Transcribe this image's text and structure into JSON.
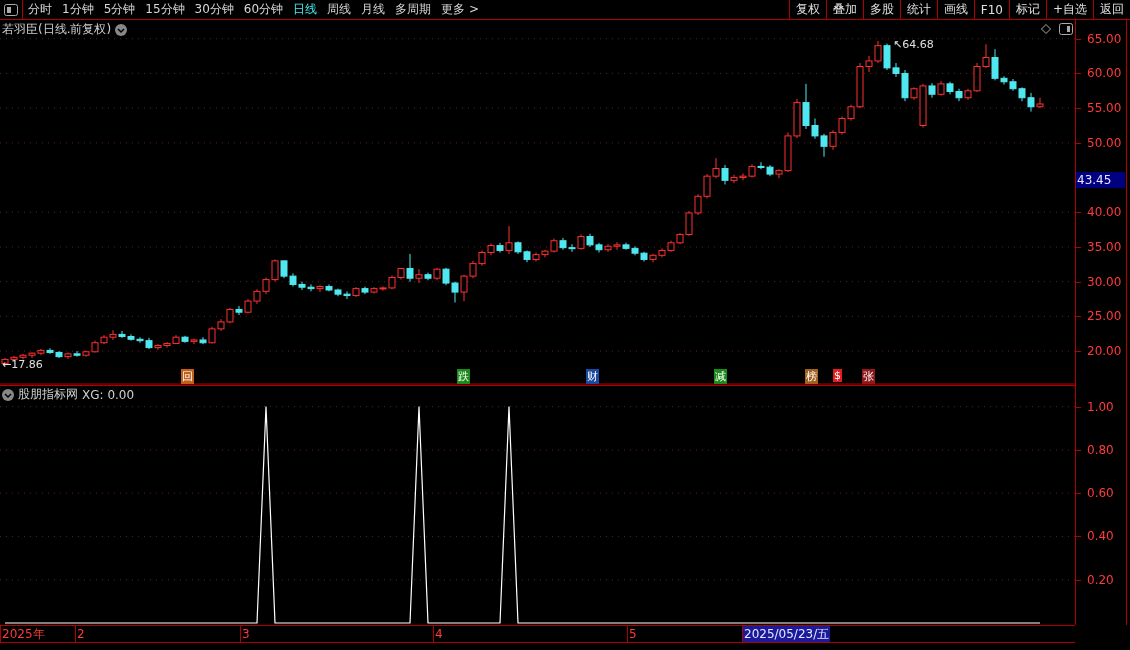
{
  "toolbar": {
    "periods": [
      {
        "label": "分时",
        "selected": false
      },
      {
        "label": "1分钟",
        "selected": false
      },
      {
        "label": "5分钟",
        "selected": false
      },
      {
        "label": "15分钟",
        "selected": false
      },
      {
        "label": "30分钟",
        "selected": false
      },
      {
        "label": "60分钟",
        "selected": false
      },
      {
        "label": "日线",
        "selected": true
      },
      {
        "label": "周线",
        "selected": false
      },
      {
        "label": "月线",
        "selected": false
      },
      {
        "label": "多周期",
        "selected": false
      }
    ],
    "more": "更多 >",
    "buttons": [
      "复权",
      "叠加",
      "多股",
      "统计",
      "画线",
      "F10",
      "标记",
      "+自选",
      "返回"
    ]
  },
  "main_chart": {
    "title": "若羽臣(日线.前复权)",
    "high_label": "↖64.68",
    "low_label": "←17.86",
    "current_price": "43.45",
    "chart_data": {
      "type": "candlestick",
      "grid": true,
      "ylim": [
        15.4,
        67.7
      ],
      "yticks": [
        {
          "value": 65,
          "label": "65.00"
        },
        {
          "value": 60,
          "label": "60.00"
        },
        {
          "value": 55,
          "label": "55.00"
        },
        {
          "value": 50,
          "label": "50.00"
        },
        {
          "value": 40,
          "label": "40.00"
        },
        {
          "value": 35,
          "label": "35.00"
        },
        {
          "value": 30,
          "label": "30.00"
        },
        {
          "value": 25,
          "label": "25.00"
        },
        {
          "value": 20,
          "label": "20.00"
        }
      ],
      "ohlc": [
        [
          18.2,
          19.0,
          17.86,
          18.8
        ],
        [
          18.8,
          19.3,
          18.5,
          19.1
        ],
        [
          19.1,
          19.6,
          18.8,
          19.4
        ],
        [
          19.4,
          19.8,
          19.0,
          19.7
        ],
        [
          19.7,
          20.3,
          19.4,
          20.1
        ],
        [
          20.1,
          20.4,
          19.6,
          19.8
        ],
        [
          19.8,
          20.0,
          19.0,
          19.2
        ],
        [
          19.2,
          19.8,
          18.9,
          19.6
        ],
        [
          19.6,
          20.0,
          19.2,
          19.4
        ],
        [
          19.4,
          20.1,
          19.2,
          19.9
        ],
        [
          19.9,
          21.5,
          19.8,
          21.2
        ],
        [
          21.2,
          22.3,
          21.0,
          22.0
        ],
        [
          22.0,
          23.0,
          21.6,
          22.4
        ],
        [
          22.4,
          22.9,
          21.9,
          22.1
        ],
        [
          22.1,
          22.4,
          21.5,
          21.7
        ],
        [
          21.7,
          22.0,
          21.2,
          21.5
        ],
        [
          21.5,
          21.9,
          20.3,
          20.5
        ],
        [
          20.5,
          21.0,
          20.2,
          20.8
        ],
        [
          20.8,
          21.3,
          20.5,
          21.1
        ],
        [
          21.1,
          22.3,
          21.0,
          22.0
        ],
        [
          22.0,
          22.2,
          21.2,
          21.4
        ],
        [
          21.4,
          21.8,
          21.0,
          21.6
        ],
        [
          21.6,
          22.0,
          21.0,
          21.2
        ],
        [
          21.2,
          23.5,
          21.1,
          23.2
        ],
        [
          23.2,
          24.6,
          22.9,
          24.2
        ],
        [
          24.2,
          26.2,
          24.0,
          26.0
        ],
        [
          26.0,
          26.5,
          25.2,
          25.6
        ],
        [
          25.6,
          27.5,
          25.4,
          27.2
        ],
        [
          27.2,
          28.9,
          26.8,
          28.6
        ],
        [
          28.6,
          30.6,
          28.2,
          30.3
        ],
        [
          30.3,
          33.2,
          30.0,
          33.0
        ],
        [
          33.0,
          33.0,
          30.5,
          30.8
        ],
        [
          30.8,
          31.2,
          29.3,
          29.6
        ],
        [
          29.6,
          30.0,
          28.8,
          29.2
        ],
        [
          29.2,
          29.6,
          28.6,
          29.0
        ],
        [
          29.0,
          29.5,
          28.5,
          29.3
        ],
        [
          29.3,
          29.6,
          28.6,
          28.8
        ],
        [
          28.8,
          29.0,
          27.9,
          28.2
        ],
        [
          28.2,
          28.6,
          27.5,
          28.0
        ],
        [
          28.0,
          29.2,
          27.8,
          29.0
        ],
        [
          29.0,
          29.3,
          28.2,
          28.5
        ],
        [
          28.5,
          29.2,
          28.3,
          29.0
        ],
        [
          29.0,
          29.3,
          28.7,
          29.1
        ],
        [
          29.1,
          30.9,
          28.9,
          30.6
        ],
        [
          30.6,
          32.0,
          30.3,
          31.9
        ],
        [
          31.9,
          34.0,
          30.0,
          30.5
        ],
        [
          30.5,
          31.8,
          29.8,
          31.0
        ],
        [
          31.0,
          31.3,
          30.2,
          30.5
        ],
        [
          30.5,
          32.0,
          30.2,
          31.8
        ],
        [
          31.8,
          32.0,
          29.5,
          29.8
        ],
        [
          29.8,
          30.0,
          27.0,
          28.5
        ],
        [
          28.5,
          31.0,
          27.2,
          30.8
        ],
        [
          30.8,
          33.0,
          30.5,
          32.6
        ],
        [
          32.6,
          34.5,
          32.3,
          34.2
        ],
        [
          34.2,
          35.5,
          33.8,
          35.2
        ],
        [
          35.2,
          35.6,
          34.2,
          34.5
        ],
        [
          34.5,
          38.0,
          34.0,
          35.6
        ],
        [
          35.6,
          35.8,
          34.0,
          34.3
        ],
        [
          34.3,
          34.5,
          32.8,
          33.2
        ],
        [
          33.2,
          34.2,
          32.9,
          33.9
        ],
        [
          33.9,
          34.6,
          33.5,
          34.4
        ],
        [
          34.4,
          36.2,
          34.2,
          35.9
        ],
        [
          35.9,
          36.3,
          34.6,
          34.9
        ],
        [
          34.9,
          35.4,
          34.3,
          34.8
        ],
        [
          34.8,
          36.8,
          34.6,
          36.5
        ],
        [
          36.5,
          36.9,
          35.0,
          35.3
        ],
        [
          35.3,
          35.6,
          34.2,
          34.6
        ],
        [
          34.6,
          35.4,
          34.3,
          35.1
        ],
        [
          35.1,
          35.7,
          34.6,
          35.3
        ],
        [
          35.3,
          35.6,
          34.6,
          34.8
        ],
        [
          34.8,
          35.1,
          33.8,
          34.1
        ],
        [
          34.1,
          34.3,
          32.9,
          33.2
        ],
        [
          33.2,
          34.0,
          32.8,
          33.8
        ],
        [
          33.8,
          34.8,
          33.5,
          34.5
        ],
        [
          34.5,
          35.9,
          34.3,
          35.6
        ],
        [
          35.6,
          37.0,
          35.4,
          36.8
        ],
        [
          36.8,
          40.2,
          36.6,
          39.9
        ],
        [
          39.9,
          42.6,
          39.6,
          42.3
        ],
        [
          42.3,
          45.5,
          42.0,
          45.2
        ],
        [
          45.2,
          47.8,
          44.9,
          46.3
        ],
        [
          46.3,
          46.8,
          44.0,
          44.6
        ],
        [
          44.6,
          45.4,
          44.2,
          45.0
        ],
        [
          45.0,
          45.6,
          44.6,
          45.2
        ],
        [
          45.2,
          46.9,
          45.0,
          46.6
        ],
        [
          46.6,
          47.2,
          46.2,
          46.5
        ],
        [
          46.5,
          46.8,
          45.2,
          45.5
        ],
        [
          45.5,
          46.2,
          44.9,
          46.0
        ],
        [
          46.0,
          51.5,
          45.8,
          51.0
        ],
        [
          51.0,
          56.3,
          50.7,
          55.8
        ],
        [
          55.8,
          58.5,
          52.0,
          52.5
        ],
        [
          52.5,
          53.5,
          50.6,
          51.0
        ],
        [
          51.0,
          51.3,
          48.0,
          49.5
        ],
        [
          49.5,
          51.8,
          49.0,
          51.5
        ],
        [
          51.5,
          53.8,
          51.2,
          53.5
        ],
        [
          53.5,
          55.5,
          53.2,
          55.2
        ],
        [
          55.2,
          61.5,
          55.0,
          61.0
        ],
        [
          61.0,
          62.5,
          60.2,
          61.8
        ],
        [
          61.8,
          64.68,
          61.5,
          64.0
        ],
        [
          64.0,
          64.3,
          60.5,
          60.8
        ],
        [
          60.8,
          61.5,
          59.5,
          60.0
        ],
        [
          60.0,
          60.5,
          56.0,
          56.5
        ],
        [
          56.5,
          58.0,
          56.2,
          57.8
        ],
        [
          52.5,
          58.5,
          52.2,
          58.2
        ],
        [
          58.2,
          58.6,
          56.5,
          57.0
        ],
        [
          57.0,
          58.9,
          56.8,
          58.5
        ],
        [
          58.5,
          58.8,
          57.0,
          57.4
        ],
        [
          57.4,
          57.8,
          56.0,
          56.5
        ],
        [
          56.5,
          57.8,
          56.2,
          57.5
        ],
        [
          57.5,
          61.5,
          57.3,
          61.0
        ],
        [
          61.0,
          64.2,
          60.8,
          62.3
        ],
        [
          62.3,
          63.5,
          59.0,
          59.3
        ],
        [
          59.3,
          59.6,
          58.4,
          58.8
        ],
        [
          58.8,
          59.2,
          57.5,
          57.8
        ],
        [
          57.8,
          58.0,
          56.0,
          56.5
        ],
        [
          56.5,
          57.2,
          54.5,
          55.2
        ],
        [
          55.2,
          56.5,
          55.0,
          55.6
        ]
      ]
    },
    "events": [
      {
        "label": "回",
        "color": "#c0601a"
      },
      {
        "label": "跌",
        "color": "#1a8a1a"
      },
      {
        "label": "财",
        "color": "#1a4aa0"
      },
      {
        "label": "减",
        "color": "#1a8a1a"
      },
      {
        "label": "榜",
        "color": "#a06020"
      },
      {
        "label": "$",
        "color": "#e02020"
      },
      {
        "label": "张",
        "color": "#901818"
      }
    ]
  },
  "indicator": {
    "name": "股朋指标网",
    "reading": "XG: 0.00",
    "chart_data": {
      "type": "line",
      "grid": true,
      "ylim": [
        0,
        1.1
      ],
      "yticks": [
        {
          "value": 1,
          "label": "1.00"
        },
        {
          "value": 0.8,
          "label": "0.80"
        },
        {
          "value": 0.6,
          "label": "0.60"
        },
        {
          "value": 0.4,
          "label": "0.40"
        },
        {
          "value": 0.2,
          "label": "0.20"
        }
      ],
      "series": [
        {
          "color": "#ffffff",
          "values": [
            0,
            0,
            0,
            0,
            0,
            0,
            0,
            0,
            0,
            0,
            0,
            0,
            0,
            0,
            0,
            0,
            0,
            0,
            0,
            0,
            0,
            0,
            0,
            0,
            0,
            0,
            0,
            0,
            0,
            1,
            0,
            0,
            0,
            0,
            0,
            0,
            0,
            0,
            0,
            0,
            0,
            0,
            0,
            0,
            0,
            0,
            1,
            0,
            0,
            0,
            0,
            0,
            0,
            0,
            0,
            0,
            1,
            0,
            0,
            0,
            0,
            0,
            0,
            0,
            0,
            0,
            0,
            0,
            0,
            0,
            0,
            0,
            0,
            0,
            0,
            0,
            0,
            0,
            0,
            0,
            0,
            0,
            0,
            0,
            0,
            0,
            0,
            0,
            0,
            0,
            0,
            0,
            0,
            0,
            0,
            0,
            0,
            0,
            0,
            0,
            0,
            0,
            0,
            0,
            0,
            0,
            0,
            0,
            0,
            0,
            0,
            0,
            0,
            0,
            0,
            0
          ]
        }
      ]
    }
  },
  "date_axis": [
    {
      "label": "2025年",
      "selected": false
    },
    {
      "label": "2",
      "selected": false
    },
    {
      "label": "3",
      "selected": false
    },
    {
      "label": "4",
      "selected": false
    },
    {
      "label": "5",
      "selected": false
    },
    {
      "label": "2025/05/23/五",
      "selected": true
    }
  ]
}
